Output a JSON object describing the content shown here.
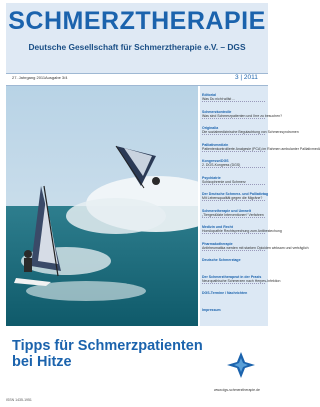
{
  "cover": {
    "title": "SCHMERZTHERAPIE",
    "subtitle": "Deutsche Gesellschaft für Schmerztherapie e.V. – DGS",
    "volume": "27. Jahrgang 2011",
    "issue_label": "Ausgabe 3/4",
    "issue_date": "3 | 2011",
    "headline_line1": "Tipps für Schmerzpatienten",
    "headline_line2": "bei Hitze",
    "url": "www.dgs-schmerztherapie.de",
    "footer_code": "ISSN 1435-1951"
  },
  "toc": [
    {
      "category": "Editorial",
      "line": "Was Du nicht willst ..."
    },
    {
      "category": "Schmerzkontrolle",
      "line": "Was sind Schmerzpatienten und Ihre zu besuchen?"
    },
    {
      "category": "Originalia",
      "line": "Die sozialmedizinische Begutachtung von Schmerzsyndromen"
    },
    {
      "category": "Palliativmedizin",
      "line": "Patientenkontrollierte Analgesie (PCA) im Rahmen ambulanter Palliativmedizin"
    },
    {
      "category": "Kongresse/DGS",
      "line": "2. DGS-Kongress (DGS)"
    },
    {
      "category": "Psychiatrie",
      "line": "Schizophrenie und Schmerz"
    },
    {
      "category": "Der Deutsche Schmerz- und Palliativtag",
      "line": "Mit Lebensqualität gegen die Migräne?"
    },
    {
      "category": "Schmerztherapie und Umwelt",
      "line": "„Tiergestützte Interventionen“ Verfahren"
    },
    {
      "category": "Medizin und Recht",
      "line": "Homöopathie Rechtsprechung zum Antibestechung"
    },
    {
      "category": "Pharmakotherapie",
      "line": "Antirheumatika werden mit starken Opioiden wirksam und verträglich"
    },
    {
      "category": "Deutsche Schmerztage",
      "line": ""
    },
    {
      "category": "Der Schmerztherapeut in der Praxis",
      "line": "Neuropathische Schmerzen nach Herpes-Infektion"
    },
    {
      "category": "DGS-Termine / Nachrichten",
      "line": ""
    },
    {
      "category": "Impressum",
      "line": ""
    }
  ],
  "colors": {
    "brand_blue": "#1b63ad",
    "masthead_bg": "#dfe9f4",
    "toc_bg": "#dce8f4"
  }
}
